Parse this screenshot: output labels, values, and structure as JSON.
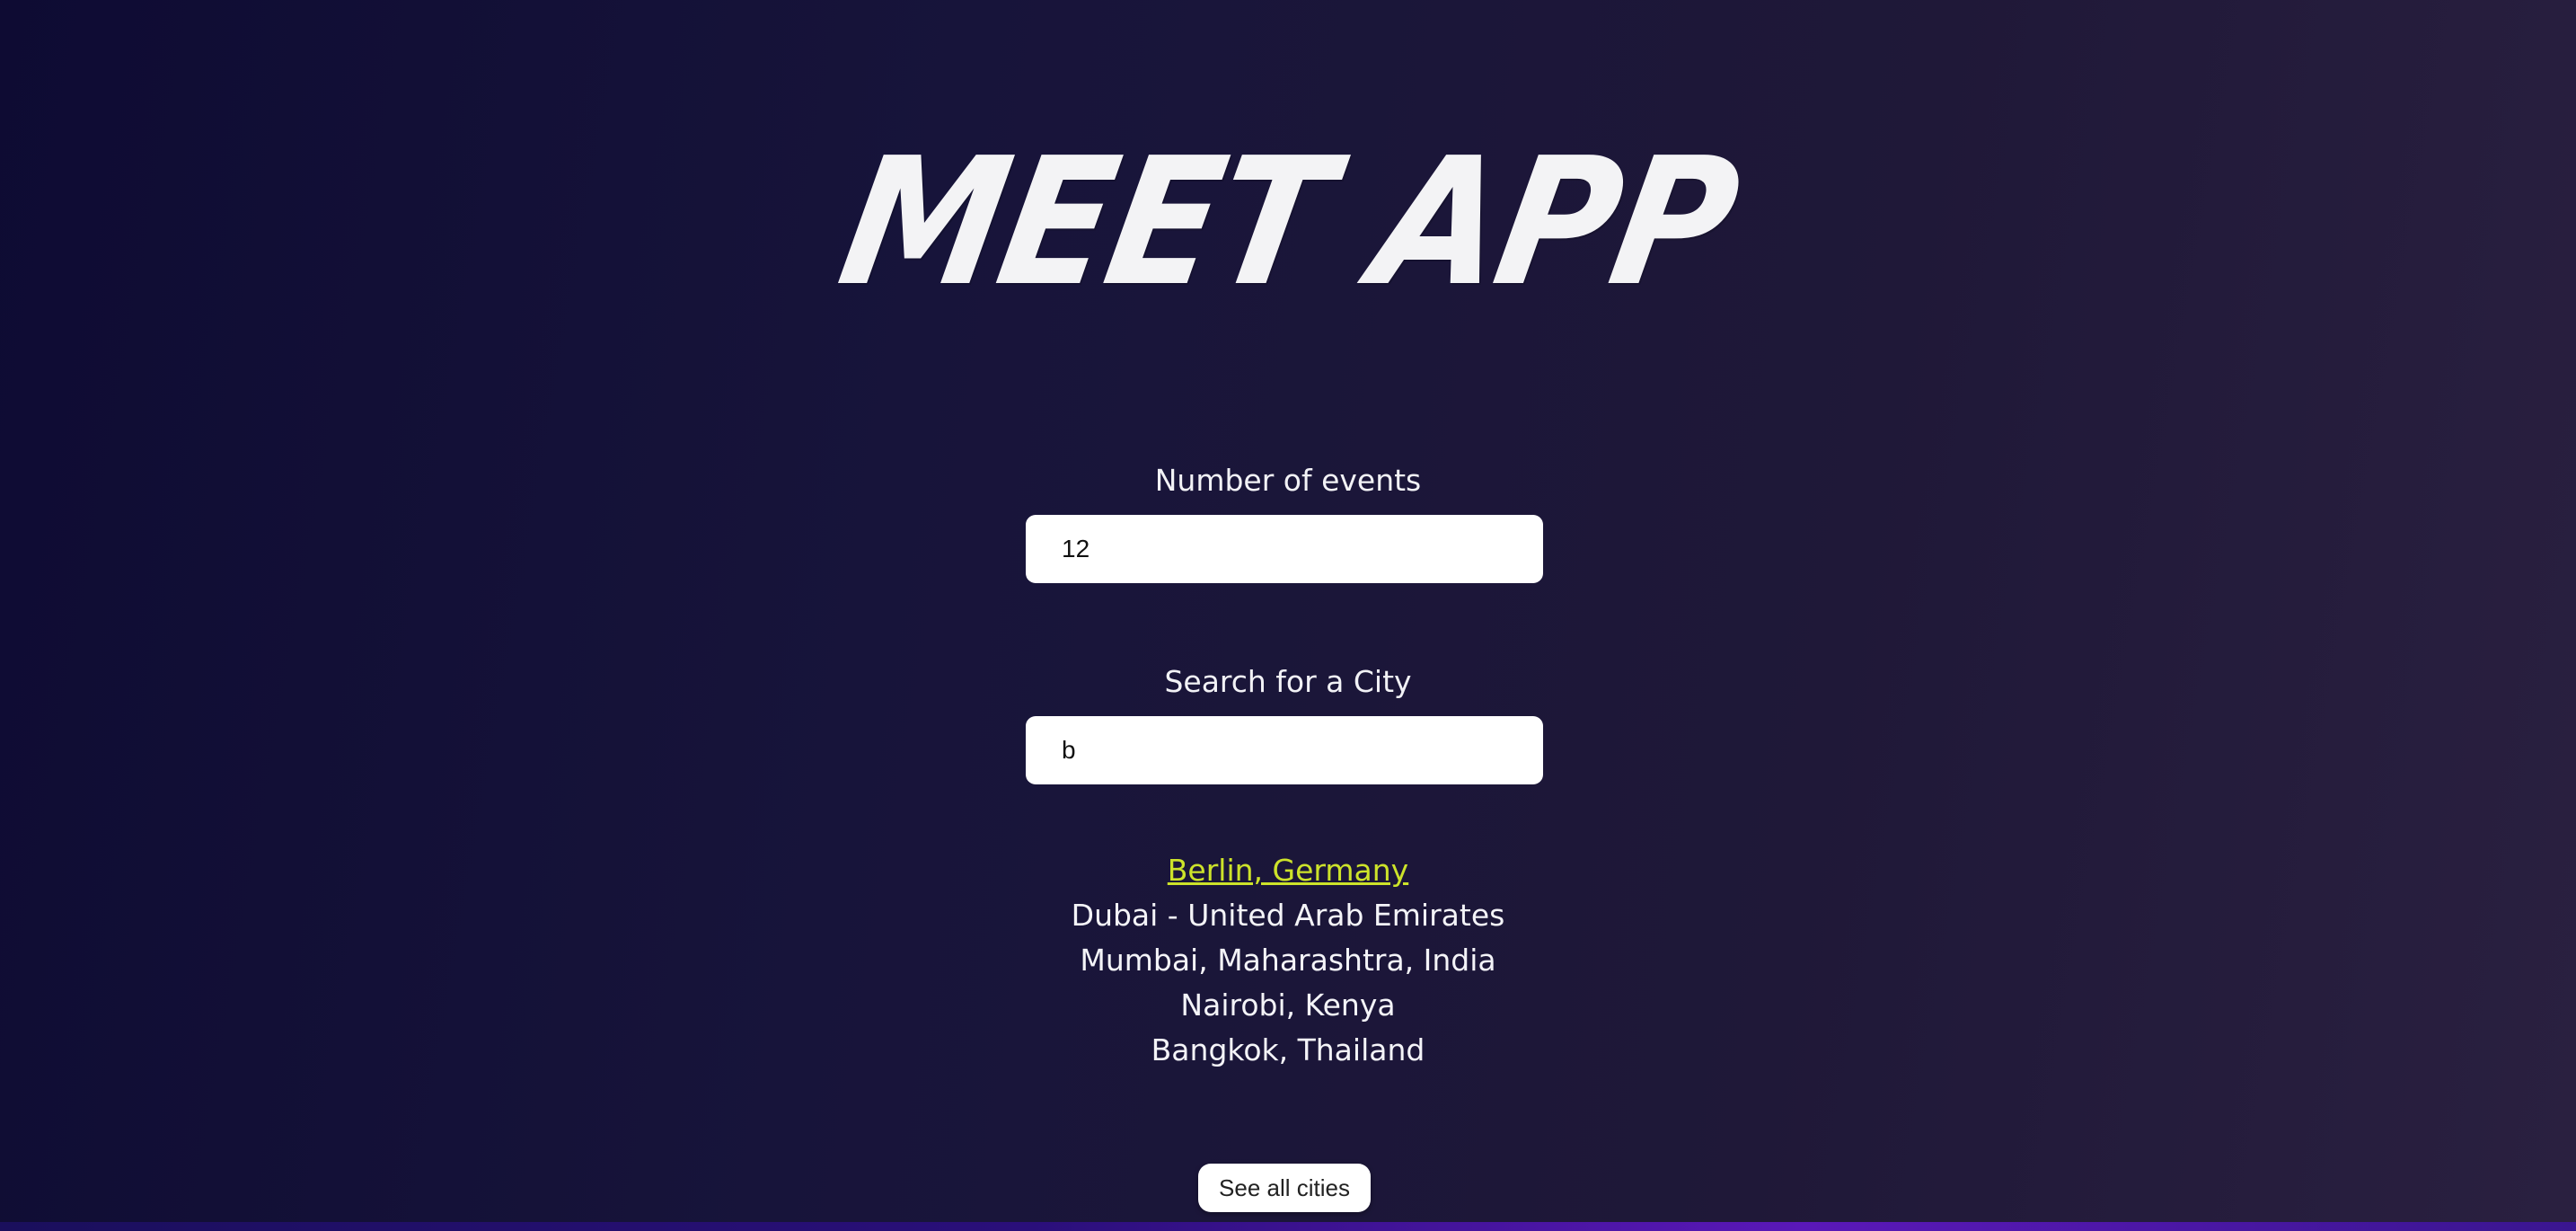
{
  "app": {
    "title": "MEET APP"
  },
  "number_of_events": {
    "label": "Number of events",
    "value": "12"
  },
  "city_search": {
    "label": "Search for a City",
    "value": "b"
  },
  "suggestions": [
    {
      "label": "Berlin, Germany",
      "active": true
    },
    {
      "label": "Dubai - United Arab Emirates",
      "active": false
    },
    {
      "label": "Mumbai, Maharashtra, India",
      "active": false
    },
    {
      "label": "Nairobi, Kenya",
      "active": false
    },
    {
      "label": "Bangkok, Thailand",
      "active": false
    }
  ],
  "see_all_button": {
    "label": "See all cities"
  },
  "colors": {
    "background_start": "#0e0b33",
    "background_end": "#2a2040",
    "highlight": "#cde32a",
    "title": "#f3f3f5"
  }
}
